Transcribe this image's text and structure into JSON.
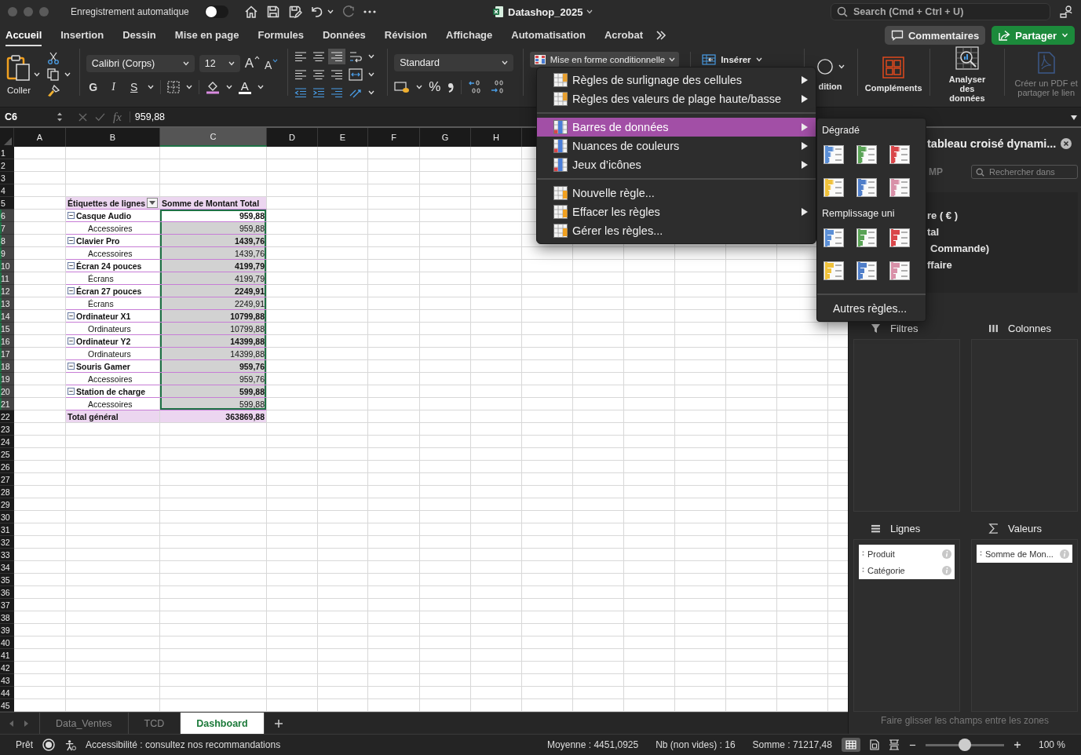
{
  "window": {
    "title": "Datashop_2025",
    "autosave_label": "Enregistrement automatique",
    "autosave_on": false,
    "search_placeholder": "Search (Cmd + Ctrl + U)"
  },
  "ribbon_tabs": [
    {
      "label": "Accueil",
      "selected": true
    },
    {
      "label": "Insertion",
      "selected": false
    },
    {
      "label": "Dessin",
      "selected": false
    },
    {
      "label": "Mise en page",
      "selected": false
    },
    {
      "label": "Formules",
      "selected": false
    },
    {
      "label": "Données",
      "selected": false
    },
    {
      "label": "Révision",
      "selected": false
    },
    {
      "label": "Affichage",
      "selected": false
    },
    {
      "label": "Automatisation",
      "selected": false
    },
    {
      "label": "Acrobat",
      "selected": false
    }
  ],
  "ribbon_actions": {
    "comments": "Commentaires",
    "share": "Partager"
  },
  "ribbon": {
    "paste": "Coller",
    "font": "Calibri (Corps)",
    "font_size": "12",
    "grow_font": "A",
    "shrink_font": "A",
    "bold": "G",
    "italic": "I",
    "underline": "S",
    "font_color": "A",
    "number_format": "Standard",
    "percent": "%",
    "conditional_format": "Mise en forme conditionnelle",
    "insert": "Insérer",
    "condition": "dition",
    "addins": "Compléments",
    "analyze": "Analyser des données",
    "pdf": "Créer un PDF et partager le lien"
  },
  "formula_bar": {
    "cell": "C6",
    "fx": "fx",
    "value": "959,88"
  },
  "columns": [
    {
      "label": "A",
      "selected": false
    },
    {
      "label": "B",
      "selected": false
    },
    {
      "label": "C",
      "selected": true
    },
    {
      "label": "D",
      "selected": false
    },
    {
      "label": "E",
      "selected": false
    },
    {
      "label": "F",
      "selected": false
    },
    {
      "label": "G",
      "selected": false
    },
    {
      "label": "H",
      "selected": false
    }
  ],
  "row_numbers": [
    "1",
    "2",
    "3",
    "4",
    "5",
    "6",
    "7",
    "8",
    "9",
    "10",
    "11",
    "12",
    "13",
    "14",
    "15",
    "16",
    "17",
    "18",
    "19",
    "20",
    "21",
    "22",
    "23",
    "24",
    "25",
    "26",
    "27",
    "28",
    "29",
    "30",
    "31",
    "32",
    "33",
    "34",
    "35",
    "36",
    "37",
    "38",
    "39",
    "40",
    "41",
    "42",
    "43",
    "44",
    "45"
  ],
  "pivot": {
    "header_label": "Étiquettes de lignes",
    "header_value": "Somme de Montant Total",
    "total_label": "Total général",
    "total_value": "363869,88",
    "rows": [
      {
        "kind": "group",
        "label": "Casque Audio",
        "value": "959,88",
        "selected": true,
        "active": true
      },
      {
        "kind": "item",
        "label": "Accessoires",
        "value": "959,88",
        "selected": true,
        "active": false
      },
      {
        "kind": "group",
        "label": "Clavier Pro",
        "value": "1439,76",
        "selected": true,
        "active": false
      },
      {
        "kind": "item",
        "label": "Accessoires",
        "value": "1439,76",
        "selected": true,
        "active": false
      },
      {
        "kind": "group",
        "label": "Écran 24 pouces",
        "value": "4199,79",
        "selected": true,
        "active": false
      },
      {
        "kind": "item",
        "label": "Écrans",
        "value": "4199,79",
        "selected": true,
        "active": false
      },
      {
        "kind": "group",
        "label": "Écran 27 pouces",
        "value": "2249,91",
        "selected": true,
        "active": false
      },
      {
        "kind": "item",
        "label": "Écrans",
        "value": "2249,91",
        "selected": true,
        "active": false
      },
      {
        "kind": "group",
        "label": "Ordinateur X1",
        "value": "10799,88",
        "selected": true,
        "active": false
      },
      {
        "kind": "item",
        "label": "Ordinateurs",
        "value": "10799,88",
        "selected": true,
        "active": false
      },
      {
        "kind": "group",
        "label": "Ordinateur Y2",
        "value": "14399,88",
        "selected": true,
        "active": false
      },
      {
        "kind": "item",
        "label": "Ordinateurs",
        "value": "14399,88",
        "selected": true,
        "active": false
      },
      {
        "kind": "group",
        "label": "Souris Gamer",
        "value": "959,76",
        "selected": true,
        "active": false
      },
      {
        "kind": "item",
        "label": "Accessoires",
        "value": "959,76",
        "selected": true,
        "active": false
      },
      {
        "kind": "group",
        "label": "Station de charge",
        "value": "599,88",
        "selected": true,
        "active": false
      },
      {
        "kind": "item",
        "label": "Accessoires",
        "value": "599,88",
        "selected": true,
        "active": false
      }
    ]
  },
  "menu": {
    "groups": [
      [
        {
          "label": "Règles de surlignage des cellules",
          "submenu": true,
          "selected": false
        },
        {
          "label": "Règles des valeurs de plage haute/basse",
          "submenu": true,
          "selected": false
        }
      ],
      [
        {
          "label": "Barres de données",
          "submenu": true,
          "selected": true
        },
        {
          "label": "Nuances de couleurs",
          "submenu": true,
          "selected": false
        },
        {
          "label": "Jeux d’icônes",
          "submenu": true,
          "selected": false
        }
      ],
      [
        {
          "label": "Nouvelle règle...",
          "submenu": false,
          "selected": false
        },
        {
          "label": "Effacer les règles",
          "submenu": true,
          "selected": false
        },
        {
          "label": "Gérer les règles...",
          "submenu": false,
          "selected": false
        }
      ]
    ]
  },
  "submenu": {
    "sections": [
      {
        "title": "Dégradé",
        "kind": "gradient",
        "swatches": [
          {
            "color": "#5b8fd6"
          },
          {
            "color": "#5aa356"
          },
          {
            "color": "#d9464a"
          },
          {
            "color": "#f0c23c"
          },
          {
            "color": "#4f7ec9"
          },
          {
            "color": "#d890a8"
          }
        ]
      },
      {
        "title": "Remplissage uni",
        "kind": "solid",
        "swatches": [
          {
            "color": "#5b8fd6"
          },
          {
            "color": "#5aa356"
          },
          {
            "color": "#d9464a"
          },
          {
            "color": "#f0c23c"
          },
          {
            "color": "#4f7ec9"
          },
          {
            "color": "#d890a8"
          }
        ]
      }
    ],
    "more": "Autres règles..."
  },
  "pivot_pane": {
    "title": "tableau croisé dynami...",
    "field_label": "MP",
    "search_placeholder": "Rechercher dans",
    "fields": [
      "re ( € )",
      "tal",
      "Commande)",
      "ffaire"
    ],
    "areas": [
      {
        "kind": "filters",
        "title": "Filtres"
      },
      {
        "kind": "columns",
        "title": "Colonnes"
      },
      {
        "kind": "rows",
        "title": "Lignes",
        "items": [
          "Produit",
          "Catégorie"
        ]
      },
      {
        "kind": "values",
        "title": "Valeurs",
        "items": [
          "Somme de Mon..."
        ]
      }
    ],
    "hint": "Faire glisser les champs entre les zones"
  },
  "sheet_tabs": [
    {
      "label": "Data_Ventes",
      "selected": false
    },
    {
      "label": "TCD",
      "selected": false
    },
    {
      "label": "Dashboard",
      "selected": true
    }
  ],
  "status": {
    "ready": "Prêt",
    "accessibility": "Accessibilité : consultez nos recommandations",
    "average": "Moyenne : 4451,0925",
    "count": "Nb (non vides) : 16",
    "sum": "Somme : 71217,48",
    "zoom": {
      "level": 0.5,
      "label": "100 %"
    }
  }
}
